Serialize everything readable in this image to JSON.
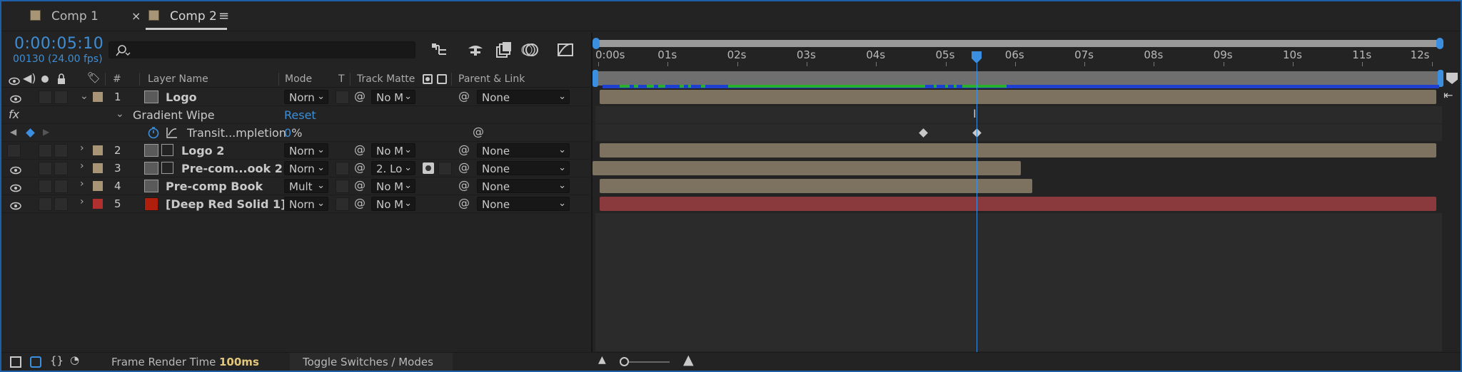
{
  "tabs": [
    {
      "label": "Comp 1",
      "active": false,
      "color": "#a89576"
    },
    {
      "label": "Comp 2",
      "active": true,
      "color": "#a89576"
    }
  ],
  "timecode": "0:00:05:10",
  "frame_info": "00130 (24.00 fps)",
  "search_icon": "search-icon",
  "columns": {
    "number": "#",
    "layer_name": "Layer Name",
    "mode": "Mode",
    "t": "T",
    "track_matte": "Track Matte",
    "parent_link": "Parent & Link"
  },
  "layers": [
    {
      "num": "1",
      "name": "Logo",
      "mode": "Norn",
      "matte": "No M",
      "parent": "None",
      "label_color": "#a89576",
      "visible": true,
      "expanded": true
    },
    {
      "num": "2",
      "name": "Logo 2",
      "mode": "Norn",
      "matte": "No M",
      "parent": "None",
      "label_color": "#a89576",
      "visible": false,
      "expanded": false
    },
    {
      "num": "3",
      "name": "Pre-com...ook 2",
      "mode": "Norn",
      "matte": "2. Lo",
      "parent": "None",
      "label_color": "#a89576",
      "visible": true,
      "expanded": false
    },
    {
      "num": "4",
      "name": "Pre-comp  Book",
      "mode": "Mult",
      "matte": "No M",
      "parent": "None",
      "label_color": "#a89576",
      "visible": true,
      "expanded": false
    },
    {
      "num": "5",
      "name": "[Deep Red Solid 1]",
      "mode": "Norn",
      "matte": "No M",
      "parent": "None",
      "label_color": "#b03030",
      "visible": true,
      "expanded": false
    }
  ],
  "effect": {
    "fx_label": "fx",
    "name": "Gradient Wipe",
    "reset": "Reset",
    "property": "Transit...mpletion",
    "value": "0",
    "unit": "%"
  },
  "ruler": [
    "0:00s",
    "01s",
    "02s",
    "03s",
    "04s",
    "05s",
    "06s",
    "07s",
    "08s",
    "09s",
    "10s",
    "11s",
    "12s"
  ],
  "footer": {
    "frame_render_label": "Frame Render Time",
    "frame_render_value": "100ms",
    "toggle_label": "Toggle Switches / Modes"
  },
  "colors": {
    "accent": "#3b8fe0",
    "bar_tan": "#7d7160",
    "bar_red": "#8a3a3d",
    "render_green": "#29b02a",
    "render_blue": "#1f3fd0"
  }
}
